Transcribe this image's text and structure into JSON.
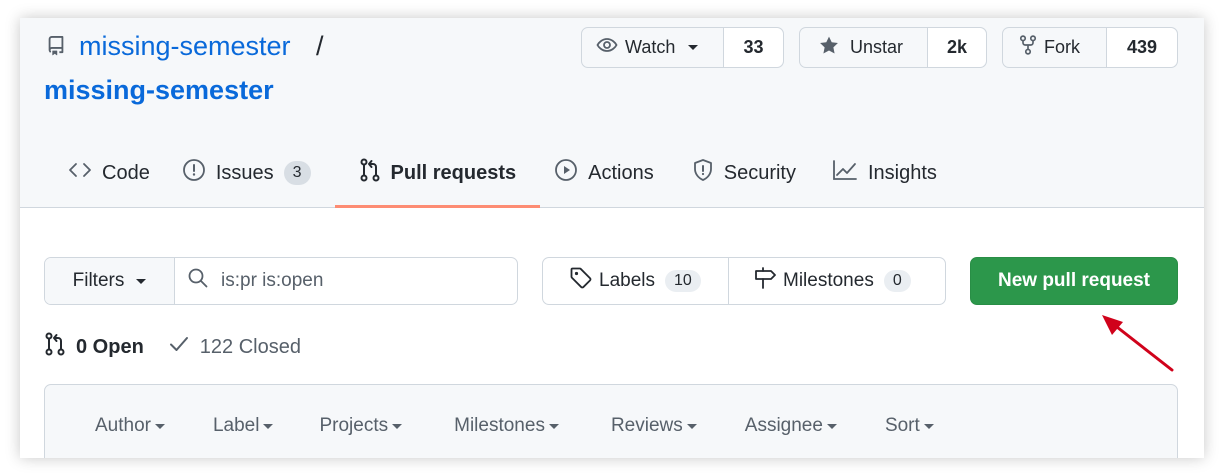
{
  "repo": {
    "owner": "missing-semester",
    "separator": "/",
    "name": "missing-semester"
  },
  "actions": {
    "watch": {
      "label": "Watch",
      "count": "33"
    },
    "star": {
      "label": "Unstar",
      "count": "2k"
    },
    "fork": {
      "label": "Fork",
      "count": "439"
    }
  },
  "tabs": [
    {
      "label": "Code",
      "icon": "code-icon"
    },
    {
      "label": "Issues",
      "icon": "issue-icon",
      "counter": "3"
    },
    {
      "label": "Pull requests",
      "icon": "pull-request-icon",
      "active": true
    },
    {
      "label": "Actions",
      "icon": "play-icon"
    },
    {
      "label": "Security",
      "icon": "shield-icon"
    },
    {
      "label": "Insights",
      "icon": "graph-icon"
    }
  ],
  "filters": {
    "button_label": "Filters",
    "search_value": "is:pr is:open"
  },
  "labels": {
    "label": "Labels",
    "count": "10"
  },
  "milestones": {
    "label": "Milestones",
    "count": "0"
  },
  "new_pr_label": "New pull request",
  "states": {
    "open": "0 Open",
    "closed": "122 Closed"
  },
  "sort_menus": [
    "Author",
    "Label",
    "Projects",
    "Milestones",
    "Reviews",
    "Assignee",
    "Sort"
  ],
  "colors": {
    "link": "#0969da",
    "primary_button": "#2c974b",
    "tab_underline": "#fd8c73",
    "annotation_arrow": "#d0021b"
  }
}
